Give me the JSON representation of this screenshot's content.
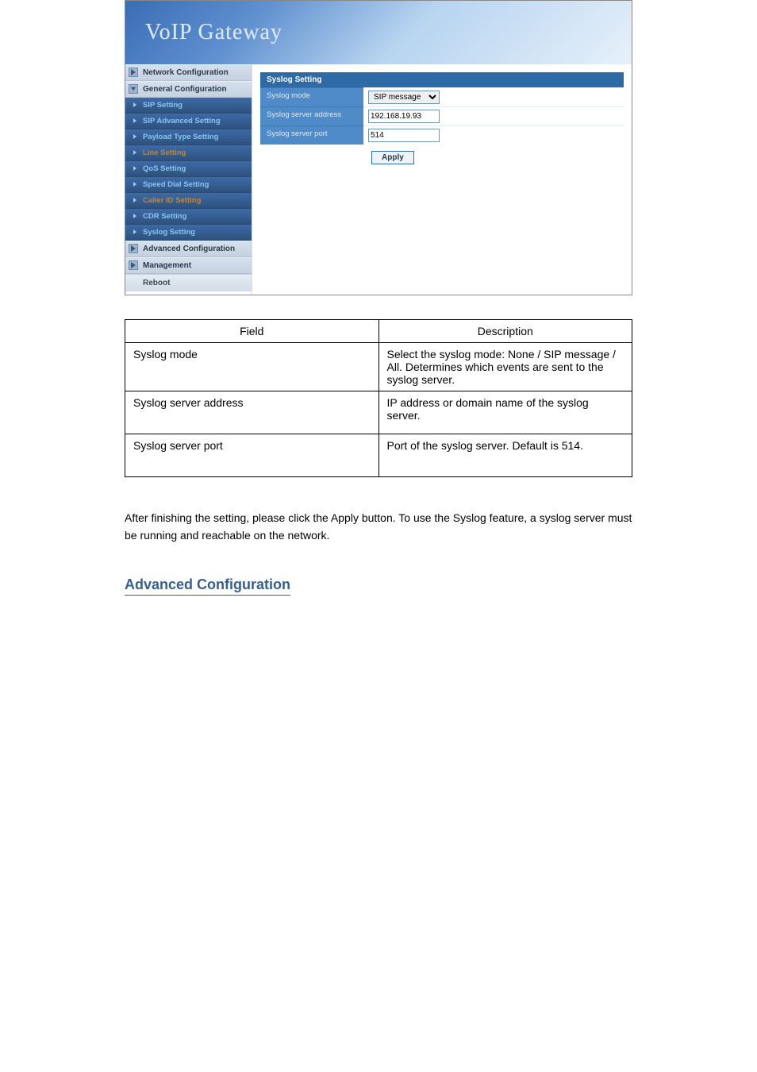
{
  "banner": {
    "title": "VoIP Gateway"
  },
  "sidebar": {
    "network": "Network Configuration",
    "general": "General Configuration",
    "items": [
      {
        "label": "SIP Setting"
      },
      {
        "label": "SIP Advanced Setting"
      },
      {
        "label": "Payload Type Setting"
      },
      {
        "label": "Line Setting"
      },
      {
        "label": "QoS Setting"
      },
      {
        "label": "Speed Dial Setting"
      },
      {
        "label": "Caller ID Setting"
      },
      {
        "label": "CDR Setting"
      },
      {
        "label": "Syslog Setting"
      }
    ],
    "advanced": "Advanced Configuration",
    "management": "Management",
    "reboot": "Reboot"
  },
  "panel": {
    "title": "Syslog Setting",
    "rows": {
      "mode_label": "Syslog mode",
      "mode_value": "SIP message",
      "addr_label": "Syslog server address",
      "addr_value": "192.168.19.93",
      "port_label": "Syslog server port",
      "port_value": "514"
    },
    "apply": "Apply"
  },
  "desc_table": {
    "head_field": "Field",
    "head_desc": "Description",
    "rows": [
      {
        "field": "Syslog mode",
        "desc": "Select the syslog mode: None / SIP message / All. Determines which events are sent to the syslog server."
      },
      {
        "field": "Syslog server address",
        "desc": "IP address or domain name of the syslog server."
      },
      {
        "field": "Syslog server port",
        "desc": "Port of the syslog server. Default is 514."
      }
    ]
  },
  "body_text": "After finishing the setting, please click the Apply button. To use the Syslog feature, a syslog server must be running and reachable on the network.",
  "section_heading": "Advanced Configuration"
}
